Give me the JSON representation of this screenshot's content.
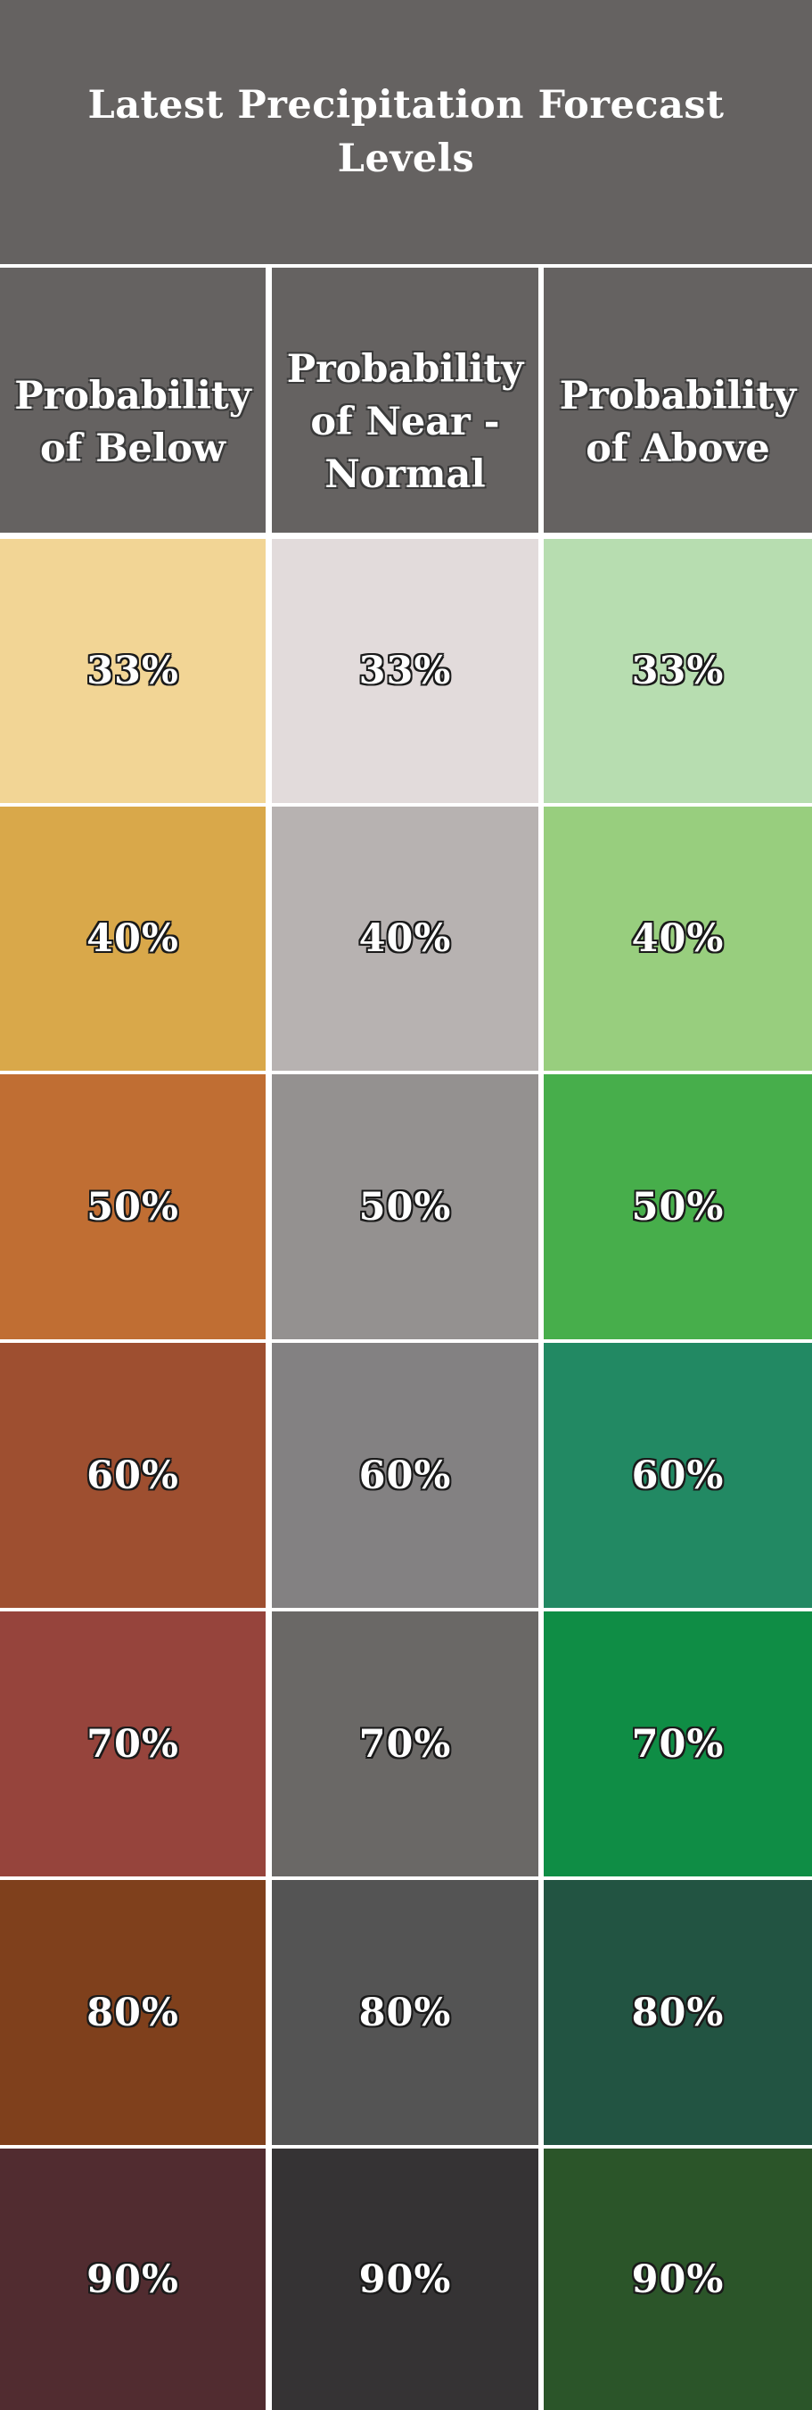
{
  "title": "Latest Precipitation Forecast Levels",
  "columns": [
    {
      "header": "Probability of Below",
      "cells": [
        {
          "label": "33%",
          "color": "#F2D595"
        },
        {
          "label": "40%",
          "color": "#D9A84A"
        },
        {
          "label": "50%",
          "color": "#C06E33"
        },
        {
          "label": "60%",
          "color": "#9E4F30"
        },
        {
          "label": "70%",
          "color": "#96443C"
        },
        {
          "label": "80%",
          "color": "#7F401C"
        },
        {
          "label": "90%",
          "color": "#512C30"
        }
      ]
    },
    {
      "header": "Probability of Near - Normal",
      "cells": [
        {
          "label": "33%",
          "color": "#E2DBDB"
        },
        {
          "label": "40%",
          "color": "#B7B2B1"
        },
        {
          "label": "50%",
          "color": "#949190"
        },
        {
          "label": "60%",
          "color": "#838182"
        },
        {
          "label": "70%",
          "color": "#6A6866"
        },
        {
          "label": "80%",
          "color": "#545454"
        },
        {
          "label": "90%",
          "color": "#353334"
        }
      ]
    },
    {
      "header": "Probability of Above",
      "cells": [
        {
          "label": "33%",
          "color": "#B7DDB0"
        },
        {
          "label": "40%",
          "color": "#98CE7E"
        },
        {
          "label": "50%",
          "color": "#47AE4B"
        },
        {
          "label": "60%",
          "color": "#228963"
        },
        {
          "label": "70%",
          "color": "#0F8D45"
        },
        {
          "label": "80%",
          "color": "#225442"
        },
        {
          "label": "90%",
          "color": "#2B5529"
        }
      ]
    }
  ]
}
